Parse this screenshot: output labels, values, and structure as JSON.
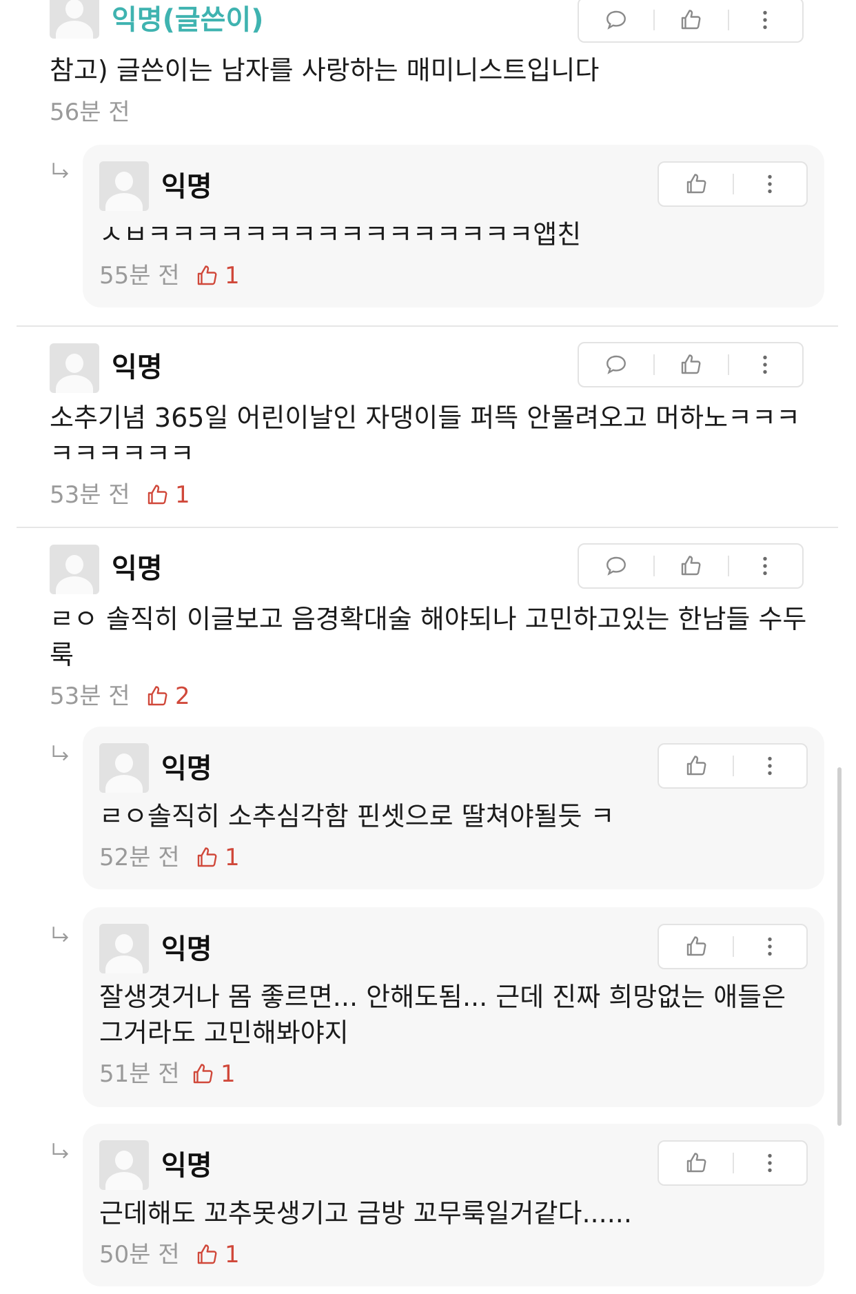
{
  "comments": [
    {
      "author": "익명(글쓴이)",
      "text": "참고) 글쓴이는 남자를 사랑하는 매미니스트입니다",
      "time": "56분 전"
    },
    {
      "author": "익명",
      "text": "ㅅㅂㅋㅋㅋㅋㅋㅋㅋㅋㅋㅋㅋㅋㅋㅋㅋㅋ앱친",
      "time": "55분 전",
      "likes": "1"
    },
    {
      "author": "익명",
      "text": "소추기념 365일 어린이날인 자댕이들 퍼뜩 안몰려오고 머하노ㅋㅋㅋㅋㅋㅋㅋㅋㅋ",
      "time": "53분 전",
      "likes": "1"
    },
    {
      "author": "익명",
      "text": "ㄹㅇ 솔직히 이글보고 음경확대술 해야되나 고민하고있는 한남들 수두룩",
      "time": "53분 전",
      "likes": "2"
    },
    {
      "author": "익명",
      "text": "ㄹㅇ솔직히 소추심각함 핀셋으로 딸쳐야될듯 ㅋ",
      "time": "52분 전",
      "likes": "1"
    },
    {
      "author": "익명",
      "text": "잘생겻거나 몸 좋르면... 안해도됨... 근데 진짜 희망없는 애들은 그거라도 고민해봐야지",
      "time": "51분 전",
      "likes": "1"
    },
    {
      "author": "익명",
      "text": "근데해도 꼬추못생기고 금방 꼬무룩일거같다......",
      "time": "50분 전",
      "likes": "1"
    }
  ],
  "icons": {
    "comment": "speech-bubble-icon",
    "like": "thumbs-up-icon",
    "more": "more-vertical-icon",
    "reply": "reply-arrow-icon"
  },
  "colors": {
    "op_author": "#3fb3b0",
    "like_count": "#d0483a",
    "muted": "#9a9a9a",
    "reply_bg": "#f7f7f7"
  }
}
